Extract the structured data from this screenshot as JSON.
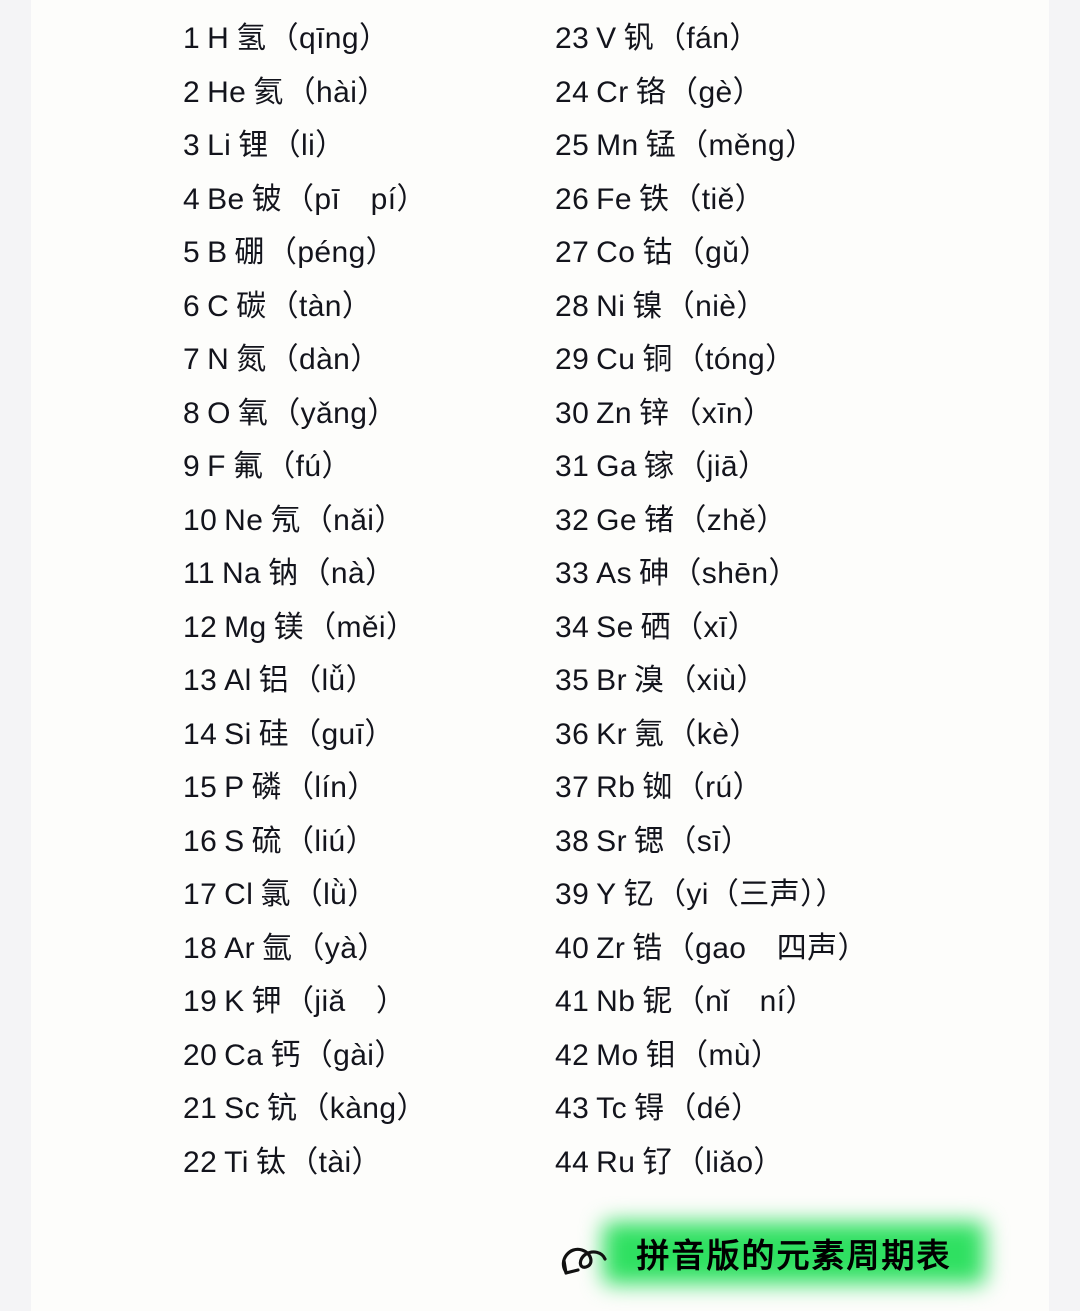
{
  "page": {
    "background_color": "#fdfdfb",
    "margin_color": "#f4f4f6"
  },
  "columns": {
    "left": [
      {
        "num": "1",
        "sym": "H",
        "han": "氢",
        "pin": "（qīng）"
      },
      {
        "num": "2",
        "sym": "He",
        "han": "氦",
        "pin": "（hài）"
      },
      {
        "num": "3",
        "sym": "Li",
        "han": "锂",
        "pin": "（li）"
      },
      {
        "num": "4",
        "sym": "Be",
        "han": "铍",
        "pin": "（pī　pí）"
      },
      {
        "num": "5",
        "sym": "B",
        "han": "硼",
        "pin": "（péng）"
      },
      {
        "num": "6",
        "sym": "C",
        "han": "碳",
        "pin": "（tàn）"
      },
      {
        "num": "7",
        "sym": "N",
        "han": "氮",
        "pin": "（dàn）"
      },
      {
        "num": "8",
        "sym": "O",
        "han": "氧",
        "pin": "（yǎng）"
      },
      {
        "num": "9",
        "sym": "F",
        "han": "氟",
        "pin": "（fú）"
      },
      {
        "num": "10",
        "sym": "Ne",
        "han": "氖",
        "pin": "（nǎi）"
      },
      {
        "num": "11",
        "sym": "Na",
        "han": "钠",
        "pin": "（nà）"
      },
      {
        "num": "12",
        "sym": "Mg",
        "han": "镁",
        "pin": "（měi）"
      },
      {
        "num": "13",
        "sym": "Al",
        "han": "铝",
        "pin": "（lǚ）"
      },
      {
        "num": "14",
        "sym": "Si",
        "han": "硅",
        "pin": "（guī）"
      },
      {
        "num": "15",
        "sym": "P",
        "han": "磷",
        "pin": "（lín）"
      },
      {
        "num": "16",
        "sym": "S",
        "han": "硫",
        "pin": "（liú）"
      },
      {
        "num": "17",
        "sym": "Cl",
        "han": "氯",
        "pin": "（lǜ）"
      },
      {
        "num": "18",
        "sym": "Ar",
        "han": "氩",
        "pin": "（yà）"
      },
      {
        "num": "19",
        "sym": "K",
        "han": "钾",
        "pin": "（jiǎ　）"
      },
      {
        "num": "20",
        "sym": "Ca",
        "han": "钙",
        "pin": "（gài）"
      },
      {
        "num": "21",
        "sym": "Sc",
        "han": "钪",
        "pin": "（kàng）"
      },
      {
        "num": "22",
        "sym": "Ti",
        "han": "钛",
        "pin": "（tài）"
      }
    ],
    "right": [
      {
        "num": "23",
        "sym": "V",
        "han": "钒",
        "pin": "（fán）"
      },
      {
        "num": "24",
        "sym": "Cr",
        "han": "铬",
        "pin": "（gè）"
      },
      {
        "num": "25",
        "sym": "Mn",
        "han": "锰",
        "pin": "（měng）"
      },
      {
        "num": "26",
        "sym": "Fe",
        "han": "铁",
        "pin": "（tiě）"
      },
      {
        "num": "27",
        "sym": "Co",
        "han": "钴",
        "pin": "（gǔ）"
      },
      {
        "num": "28",
        "sym": "Ni",
        "han": "镍",
        "pin": "（niè）"
      },
      {
        "num": "29",
        "sym": "Cu",
        "han": "铜",
        "pin": "（tóng）"
      },
      {
        "num": "30",
        "sym": "Zn",
        "han": "锌",
        "pin": "（xīn）"
      },
      {
        "num": "31",
        "sym": "Ga",
        "han": "镓",
        "pin": "（jiā）"
      },
      {
        "num": "32",
        "sym": "Ge",
        "han": "锗",
        "pin": "（zhě）"
      },
      {
        "num": "33",
        "sym": "As",
        "han": "砷",
        "pin": "（shēn）"
      },
      {
        "num": "34",
        "sym": "Se",
        "han": "硒",
        "pin": "（xī）"
      },
      {
        "num": "35",
        "sym": "Br",
        "han": "溴",
        "pin": "（xiù）"
      },
      {
        "num": "36",
        "sym": "Kr",
        "han": "氪",
        "pin": "（kè）"
      },
      {
        "num": "37",
        "sym": "Rb",
        "han": "铷",
        "pin": "（rú）"
      },
      {
        "num": "38",
        "sym": "Sr",
        "han": "锶",
        "pin": "（sī）"
      },
      {
        "num": "39",
        "sym": "Y",
        "han": "钇",
        "pin": "（yi（三声））"
      },
      {
        "num": "40",
        "sym": "Zr",
        "han": "锆",
        "pin": "（gao　四声）"
      },
      {
        "num": "41",
        "sym": "Nb",
        "han": "铌",
        "pin": "（nǐ　ní）"
      },
      {
        "num": "42",
        "sym": "Mo",
        "han": "钼",
        "pin": "（mù）"
      },
      {
        "num": "43",
        "sym": "Tc",
        "han": "锝",
        "pin": "（dé）"
      },
      {
        "num": "44",
        "sym": "Ru",
        "han": "钌",
        "pin": "（liǎo）"
      }
    ]
  },
  "badge": {
    "label": "拼音版的元素周期表",
    "glow_color": "#2fe061",
    "text_color": "#000000",
    "arrow_icon": "curly-arrow-icon"
  }
}
